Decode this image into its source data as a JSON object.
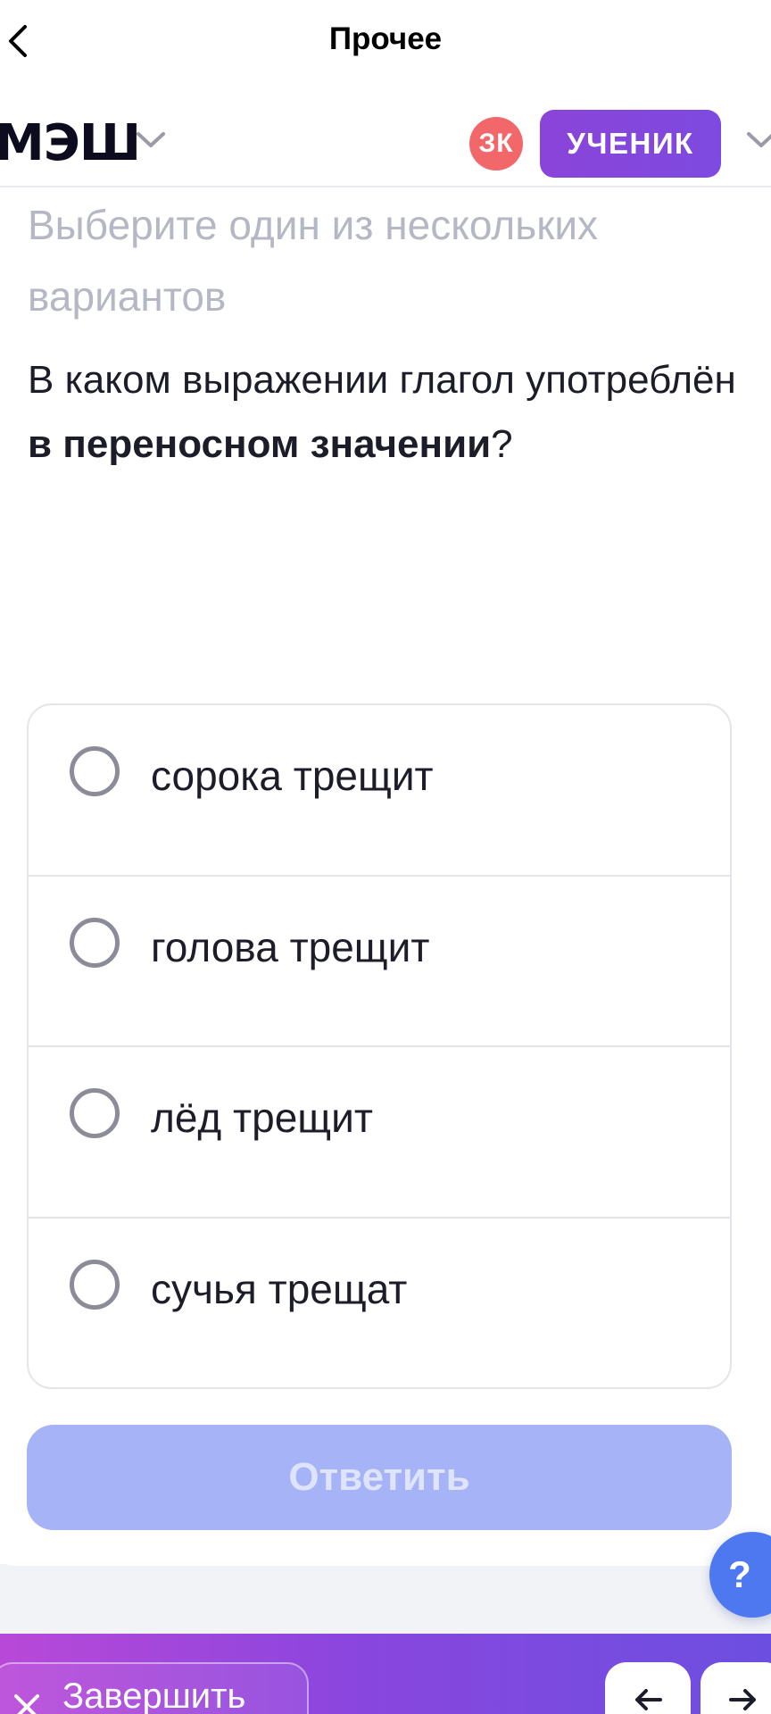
{
  "topbar": {
    "title": "Прочее"
  },
  "header": {
    "brand": "МЭШ",
    "avatar_initials": "ЗК",
    "role_label": "УЧЕНИК"
  },
  "task": {
    "hint": "Выберите один из нескольких вариантов",
    "question_prefix": "В каком выражении глагол употреблён ",
    "question_emphasis": "в переносном значении",
    "question_suffix": "?",
    "options": [
      {
        "label": "сорока трещит",
        "selected": false
      },
      {
        "label": "голова трещит",
        "selected": false
      },
      {
        "label": "лёд трещит",
        "selected": false
      },
      {
        "label": "сучья трещат",
        "selected": false
      }
    ],
    "submit_label": "Ответить"
  },
  "help": {
    "label": "?"
  },
  "footer": {
    "finish_label": "Завершить"
  },
  "colors": {
    "accent": "#8b44d9",
    "submit_disabled": "#a6b3f7",
    "help": "#4d78f0",
    "avatar": "#f2676a"
  }
}
